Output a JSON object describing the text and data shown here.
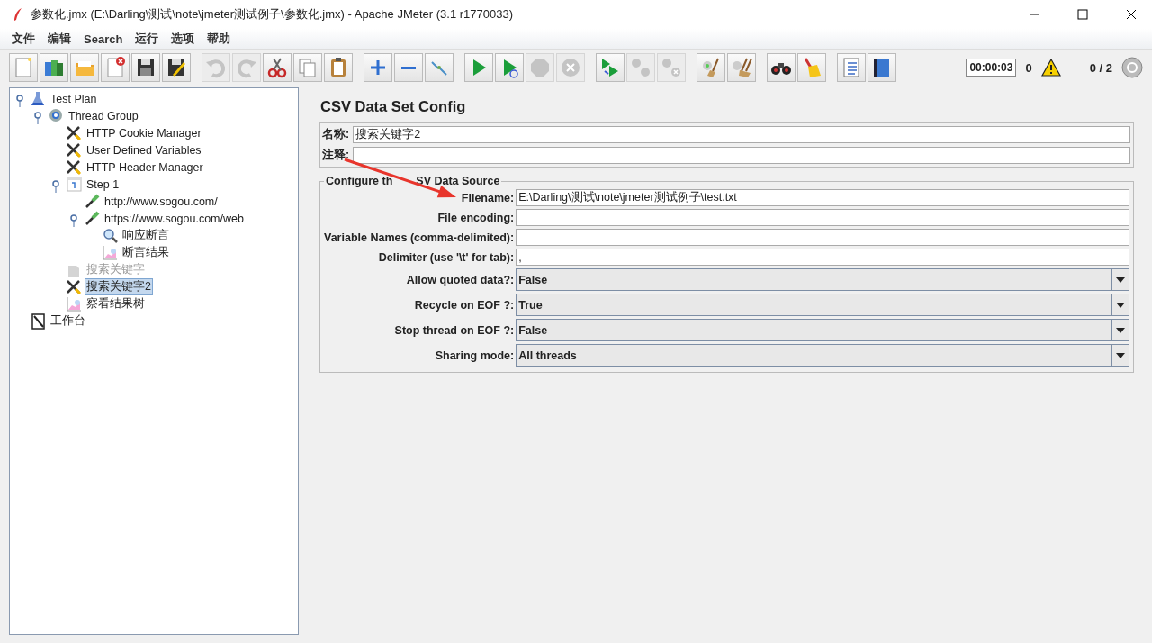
{
  "window": {
    "title": "参数化.jmx (E:\\Darling\\测试\\note\\jmeter测试例子\\参数化.jmx) - Apache JMeter (3.1 r1770033)"
  },
  "menu": [
    "文件",
    "编辑",
    "Search",
    "运行",
    "选项",
    "帮助"
  ],
  "toolbar": [
    {
      "kind": "new",
      "disabled": false
    },
    {
      "kind": "templates",
      "disabled": false
    },
    {
      "kind": "open",
      "disabled": false
    },
    {
      "kind": "close",
      "disabled": false
    },
    {
      "kind": "save",
      "disabled": false
    },
    {
      "kind": "save-as",
      "disabled": false
    },
    {
      "kind": "undo",
      "disabled": true
    },
    {
      "kind": "redo",
      "disabled": true
    },
    {
      "kind": "cut",
      "disabled": false
    },
    {
      "kind": "copy",
      "disabled": false
    },
    {
      "kind": "paste",
      "disabled": false
    },
    {
      "kind": "expand",
      "disabled": false
    },
    {
      "kind": "collapse",
      "disabled": false
    },
    {
      "kind": "toggle",
      "disabled": false
    },
    {
      "kind": "start",
      "disabled": false
    },
    {
      "kind": "start-no-timers",
      "disabled": false
    },
    {
      "kind": "stop",
      "disabled": true
    },
    {
      "kind": "shutdown",
      "disabled": true
    },
    {
      "kind": "remote-start",
      "disabled": false
    },
    {
      "kind": "remote-stop",
      "disabled": true
    },
    {
      "kind": "remote-exit",
      "disabled": true
    },
    {
      "kind": "clear",
      "disabled": false
    },
    {
      "kind": "clear-all",
      "disabled": false
    },
    {
      "kind": "search",
      "disabled": false
    },
    {
      "kind": "reset-search",
      "disabled": false
    },
    {
      "kind": "function-helper",
      "disabled": false
    },
    {
      "kind": "help",
      "disabled": false
    }
  ],
  "status": {
    "timer": "00:00:03",
    "warnings": "0",
    "threads": "0 / 2"
  },
  "tree": [
    {
      "label": "Test Plan",
      "kind": "testplan",
      "selected": false,
      "disabled": false,
      "expanded": true,
      "children": [
        {
          "label": "Thread Group",
          "kind": "threadgroup",
          "selected": false,
          "disabled": false,
          "expanded": true,
          "children": [
            {
              "label": "HTTP Cookie Manager",
              "kind": "config",
              "selected": false,
              "disabled": false
            },
            {
              "label": "User Defined Variables",
              "kind": "config",
              "selected": false,
              "disabled": false
            },
            {
              "label": "HTTP Header Manager",
              "kind": "config",
              "selected": false,
              "disabled": false
            },
            {
              "label": "Step 1",
              "kind": "controller",
              "selected": false,
              "disabled": false,
              "expanded": true,
              "children": [
                {
                  "label": "http://www.sogou.com/",
                  "kind": "sampler",
                  "selected": false,
                  "disabled": false
                },
                {
                  "label": "https://www.sogou.com/web",
                  "kind": "sampler",
                  "selected": false,
                  "disabled": false,
                  "expanded": true,
                  "children": [
                    {
                      "label": "响应断言",
                      "kind": "assertion",
                      "selected": false,
                      "disabled": false
                    },
                    {
                      "label": "断言结果",
                      "kind": "listener",
                      "selected": false,
                      "disabled": false
                    }
                  ]
                }
              ]
            },
            {
              "label": "搜索关键字",
              "kind": "config",
              "selected": false,
              "disabled": true
            },
            {
              "label": "搜索关键字2",
              "kind": "config",
              "selected": true,
              "disabled": false
            },
            {
              "label": "察看结果树",
              "kind": "listener",
              "selected": false,
              "disabled": false
            }
          ]
        }
      ]
    },
    {
      "label": "工作台",
      "kind": "workbench",
      "selected": false,
      "disabled": false
    }
  ],
  "panel": {
    "title": "CSV Data Set Config",
    "name_label": "名称:",
    "name_value": "搜索关键字2",
    "comment_label": "注释:",
    "group_title": [
      "Configure th",
      "SV Data Source"
    ],
    "fields": [
      {
        "label": "Filename:",
        "kind": "text",
        "value": "E:\\Darling\\测试\\note\\jmeter测试例子\\test.txt"
      },
      {
        "label": "File encoding:",
        "kind": "text"
      },
      {
        "label": "Variable Names (comma-delimited):",
        "kind": "text"
      },
      {
        "label": "Delimiter (use '\\t' for tab):",
        "kind": "text",
        "value": ","
      },
      {
        "label": "Allow quoted data?:",
        "kind": "select",
        "value": "False"
      },
      {
        "label": "Recycle on EOF ?:",
        "kind": "select",
        "value": "True"
      },
      {
        "label": "Stop thread on EOF ?:",
        "kind": "select",
        "value": "False"
      },
      {
        "label": "Sharing mode:",
        "kind": "select",
        "value": "All threads"
      }
    ]
  }
}
